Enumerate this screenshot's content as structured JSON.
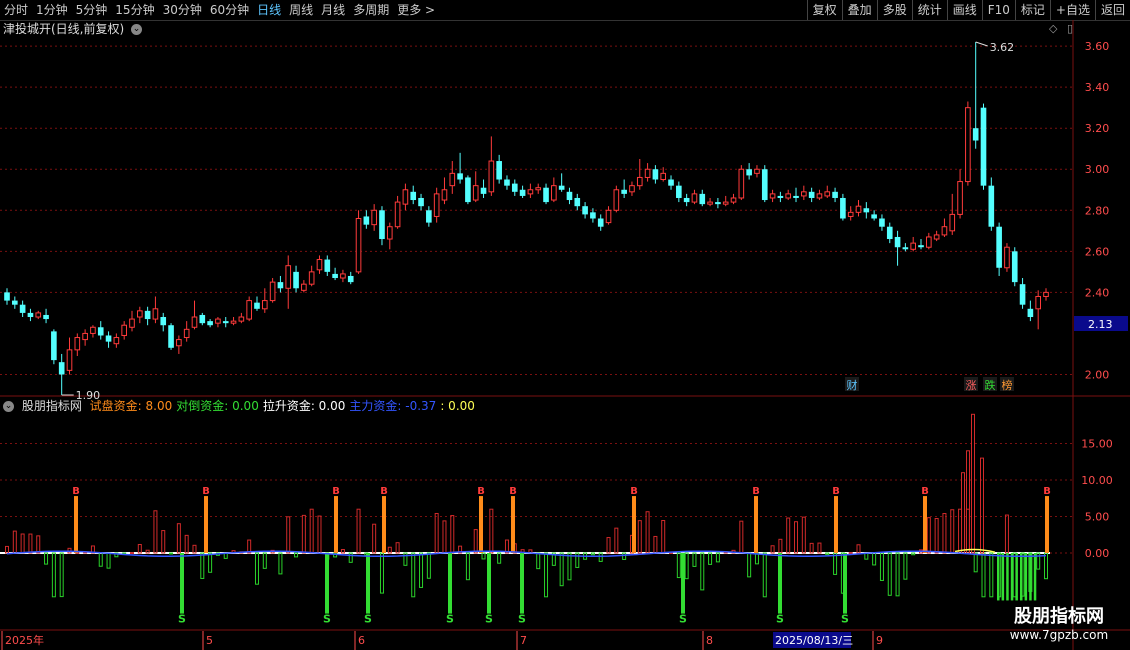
{
  "toolbar": {
    "periods": [
      "分时",
      "1分钟",
      "5分钟",
      "15分钟",
      "30分钟",
      "60分钟",
      "日线",
      "周线",
      "月线",
      "多周期",
      "更多"
    ],
    "active_index": 6,
    "more_arrow": ">",
    "right_buttons": [
      "复权",
      "叠加",
      "多股",
      "统计",
      "画线",
      "F10",
      "标记",
      "+自选",
      "返回"
    ]
  },
  "chart": {
    "title": "津投城开(日线,前复权)",
    "high_label": "3.62",
    "low_label": "1.90",
    "current_price": "2.13",
    "price_ticks": [
      "3.60",
      "3.40",
      "3.20",
      "3.00",
      "2.80",
      "2.60",
      "2.40",
      "2.00"
    ],
    "price_ticks_values": [
      3.6,
      3.4,
      3.2,
      3.0,
      2.8,
      2.6,
      2.4,
      2.0
    ],
    "event_markers": [
      {
        "text": "财",
        "color": "#5ec6ff"
      },
      {
        "text": "涨",
        "color": "#ff6060"
      },
      {
        "text": "跌",
        "color": "#33dd33"
      },
      {
        "text": "榜",
        "color": "#ff9933"
      }
    ]
  },
  "indicator": {
    "name": "股朋指标网",
    "items": [
      {
        "label": "试盘资金:",
        "value": "8.00",
        "color": "#ff8c1a"
      },
      {
        "label": "对倒资金:",
        "value": "0.00",
        "color": "#33dd33"
      },
      {
        "label": "拉升资金:",
        "value": "0.00",
        "color": "#ffffff"
      },
      {
        "label": "主力资金:",
        "value": "-0.37",
        "color": "#3355ff"
      },
      {
        "label": ":",
        "value": "0.00",
        "color": "#ffff55"
      }
    ],
    "y_ticks": [
      "15.00",
      "10.00",
      "5.00",
      "0.00"
    ],
    "y_ticks_values": [
      15,
      10,
      5,
      0
    ],
    "buy_marker": "B",
    "sell_marker": "S"
  },
  "x_axis": {
    "labels": [
      "2025年",
      "5",
      "6",
      "7",
      "8",
      "9"
    ],
    "highlight_date": "2025/08/13/三"
  },
  "watermark": {
    "line1": "股朋指标网",
    "line2": "www.7gpzb.com"
  },
  "colors": {
    "up": "#ff3b3b",
    "down": "#54ffff",
    "grid": "#7a1010",
    "axis_text": "#ff4d4d",
    "price_tag_bg": "#0a0a8c"
  },
  "chart_data": {
    "type": "candlestick",
    "price_min": 1.9,
    "price_max": 3.62,
    "candles": [
      [
        2.4,
        2.36,
        2.42,
        2.34
      ],
      [
        2.36,
        2.34,
        2.38,
        2.32
      ],
      [
        2.34,
        2.3,
        2.36,
        2.28
      ],
      [
        2.3,
        2.28,
        2.32,
        2.26
      ],
      [
        2.28,
        2.3,
        2.31,
        2.27
      ],
      [
        2.29,
        2.27,
        2.32,
        2.25
      ],
      [
        2.21,
        2.07,
        2.22,
        2.05
      ],
      [
        2.06,
        2.0,
        2.1,
        1.9
      ],
      [
        2.02,
        2.12,
        2.18,
        2.0
      ],
      [
        2.12,
        2.18,
        2.2,
        2.09
      ],
      [
        2.17,
        2.2,
        2.22,
        2.14
      ],
      [
        2.2,
        2.23,
        2.24,
        2.18
      ],
      [
        2.23,
        2.19,
        2.26,
        2.17
      ],
      [
        2.19,
        2.16,
        2.21,
        2.13
      ],
      [
        2.15,
        2.18,
        2.2,
        2.13
      ],
      [
        2.19,
        2.24,
        2.26,
        2.17
      ],
      [
        2.23,
        2.27,
        2.31,
        2.21
      ],
      [
        2.28,
        2.31,
        2.33,
        2.25
      ],
      [
        2.31,
        2.27,
        2.33,
        2.24
      ],
      [
        2.27,
        2.32,
        2.38,
        2.25
      ],
      [
        2.28,
        2.24,
        2.3,
        2.21
      ],
      [
        2.24,
        2.13,
        2.25,
        2.12
      ],
      [
        2.14,
        2.17,
        2.19,
        2.1
      ],
      [
        2.18,
        2.22,
        2.26,
        2.16
      ],
      [
        2.23,
        2.28,
        2.36,
        2.22
      ],
      [
        2.29,
        2.25,
        2.3,
        2.24
      ],
      [
        2.26,
        2.24,
        2.27,
        2.23
      ],
      [
        2.25,
        2.27,
        2.28,
        2.23
      ],
      [
        2.26,
        2.25,
        2.28,
        2.23
      ],
      [
        2.25,
        2.26,
        2.28,
        2.24
      ],
      [
        2.26,
        2.28,
        2.3,
        2.25
      ],
      [
        2.27,
        2.36,
        2.38,
        2.26
      ],
      [
        2.35,
        2.32,
        2.38,
        2.31
      ],
      [
        2.32,
        2.36,
        2.42,
        2.3
      ],
      [
        2.36,
        2.45,
        2.47,
        2.35
      ],
      [
        2.45,
        2.42,
        2.48,
        2.4
      ],
      [
        2.42,
        2.53,
        2.58,
        2.32
      ],
      [
        2.5,
        2.42,
        2.53,
        2.4
      ],
      [
        2.41,
        2.44,
        2.46,
        2.4
      ],
      [
        2.44,
        2.5,
        2.53,
        2.43
      ],
      [
        2.51,
        2.56,
        2.58,
        2.49
      ],
      [
        2.56,
        2.5,
        2.58,
        2.48
      ],
      [
        2.49,
        2.47,
        2.52,
        2.46
      ],
      [
        2.47,
        2.49,
        2.51,
        2.45
      ],
      [
        2.48,
        2.45,
        2.5,
        2.44
      ],
      [
        2.5,
        2.76,
        2.8,
        2.49
      ],
      [
        2.77,
        2.73,
        2.8,
        2.71
      ],
      [
        2.73,
        2.8,
        2.83,
        2.7
      ],
      [
        2.8,
        2.66,
        2.82,
        2.63
      ],
      [
        2.66,
        2.72,
        2.74,
        2.61
      ],
      [
        2.72,
        2.84,
        2.87,
        2.71
      ],
      [
        2.83,
        2.9,
        2.93,
        2.8
      ],
      [
        2.89,
        2.85,
        2.92,
        2.83
      ],
      [
        2.86,
        2.82,
        2.88,
        2.8
      ],
      [
        2.8,
        2.74,
        2.82,
        2.72
      ],
      [
        2.77,
        2.88,
        2.91,
        2.74
      ],
      [
        2.85,
        2.9,
        2.96,
        2.83
      ],
      [
        2.92,
        2.98,
        3.04,
        2.88
      ],
      [
        2.98,
        2.95,
        3.08,
        2.93
      ],
      [
        2.96,
        2.84,
        2.97,
        2.83
      ],
      [
        2.85,
        2.92,
        2.99,
        2.84
      ],
      [
        2.91,
        2.88,
        2.95,
        2.86
      ],
      [
        2.89,
        3.04,
        3.16,
        2.87
      ],
      [
        3.04,
        2.95,
        3.07,
        2.93
      ],
      [
        2.95,
        2.92,
        2.97,
        2.9
      ],
      [
        2.93,
        2.89,
        2.95,
        2.87
      ],
      [
        2.9,
        2.87,
        2.92,
        2.86
      ],
      [
        2.88,
        2.9,
        2.93,
        2.86
      ],
      [
        2.9,
        2.91,
        2.93,
        2.88
      ],
      [
        2.91,
        2.84,
        2.93,
        2.83
      ],
      [
        2.85,
        2.92,
        2.96,
        2.84
      ],
      [
        2.92,
        2.9,
        2.98,
        2.89
      ],
      [
        2.89,
        2.85,
        2.91,
        2.83
      ],
      [
        2.86,
        2.82,
        2.88,
        2.8
      ],
      [
        2.82,
        2.78,
        2.84,
        2.76
      ],
      [
        2.79,
        2.76,
        2.81,
        2.74
      ],
      [
        2.76,
        2.72,
        2.78,
        2.7
      ],
      [
        2.74,
        2.8,
        2.82,
        2.73
      ],
      [
        2.8,
        2.9,
        2.92,
        2.79
      ],
      [
        2.9,
        2.88,
        2.95,
        2.86
      ],
      [
        2.89,
        2.92,
        2.94,
        2.87
      ],
      [
        2.92,
        2.96,
        3.05,
        2.9
      ],
      [
        2.96,
        3.0,
        3.03,
        2.94
      ],
      [
        3.0,
        2.95,
        3.02,
        2.93
      ],
      [
        2.95,
        2.98,
        3.01,
        2.94
      ],
      [
        2.95,
        2.92,
        2.97,
        2.9
      ],
      [
        2.92,
        2.86,
        2.94,
        2.84
      ],
      [
        2.86,
        2.84,
        2.88,
        2.82
      ],
      [
        2.84,
        2.88,
        2.9,
        2.83
      ],
      [
        2.88,
        2.83,
        2.9,
        2.82
      ],
      [
        2.83,
        2.84,
        2.86,
        2.82
      ],
      [
        2.84,
        2.83,
        2.86,
        2.81
      ],
      [
        2.83,
        2.84,
        2.87,
        2.82
      ],
      [
        2.84,
        2.86,
        2.88,
        2.83
      ],
      [
        2.86,
        3.0,
        3.02,
        2.85
      ],
      [
        3.0,
        2.97,
        3.03,
        2.95
      ],
      [
        2.98,
        3.0,
        3.02,
        2.96
      ],
      [
        3.0,
        2.85,
        3.02,
        2.84
      ],
      [
        2.86,
        2.88,
        2.9,
        2.84
      ],
      [
        2.87,
        2.86,
        2.89,
        2.84
      ],
      [
        2.86,
        2.88,
        2.9,
        2.85
      ],
      [
        2.87,
        2.86,
        2.91,
        2.84
      ],
      [
        2.87,
        2.89,
        2.92,
        2.85
      ],
      [
        2.89,
        2.86,
        2.91,
        2.84
      ],
      [
        2.86,
        2.88,
        2.9,
        2.85
      ],
      [
        2.87,
        2.89,
        2.92,
        2.86
      ],
      [
        2.89,
        2.86,
        2.91,
        2.84
      ],
      [
        2.86,
        2.76,
        2.88,
        2.75
      ],
      [
        2.77,
        2.79,
        2.82,
        2.75
      ],
      [
        2.79,
        2.82,
        2.85,
        2.77
      ],
      [
        2.81,
        2.79,
        2.84,
        2.76
      ],
      [
        2.78,
        2.76,
        2.8,
        2.75
      ],
      [
        2.76,
        2.72,
        2.78,
        2.7
      ],
      [
        2.72,
        2.66,
        2.74,
        2.64
      ],
      [
        2.67,
        2.62,
        2.7,
        2.53
      ],
      [
        2.62,
        2.61,
        2.64,
        2.6
      ],
      [
        2.61,
        2.64,
        2.67,
        2.6
      ],
      [
        2.63,
        2.62,
        2.66,
        2.61
      ],
      [
        2.62,
        2.67,
        2.69,
        2.61
      ],
      [
        2.66,
        2.68,
        2.7,
        2.65
      ],
      [
        2.68,
        2.72,
        2.76,
        2.67
      ],
      [
        2.7,
        2.78,
        2.88,
        2.68
      ],
      [
        2.78,
        2.94,
        3.0,
        2.76
      ],
      [
        2.94,
        3.3,
        3.33,
        2.92
      ],
      [
        3.2,
        3.14,
        3.62,
        3.1
      ],
      [
        3.3,
        2.92,
        3.32,
        2.9
      ],
      [
        2.92,
        2.72,
        2.96,
        2.7
      ],
      [
        2.72,
        2.52,
        2.74,
        2.48
      ],
      [
        2.52,
        2.62,
        2.64,
        2.5
      ],
      [
        2.6,
        2.45,
        2.62,
        2.43
      ],
      [
        2.44,
        2.34,
        2.47,
        2.32
      ],
      [
        2.32,
        2.28,
        2.36,
        2.26
      ],
      [
        2.32,
        2.38,
        2.41,
        2.22
      ],
      [
        2.38,
        2.4,
        2.42,
        2.36
      ]
    ]
  }
}
